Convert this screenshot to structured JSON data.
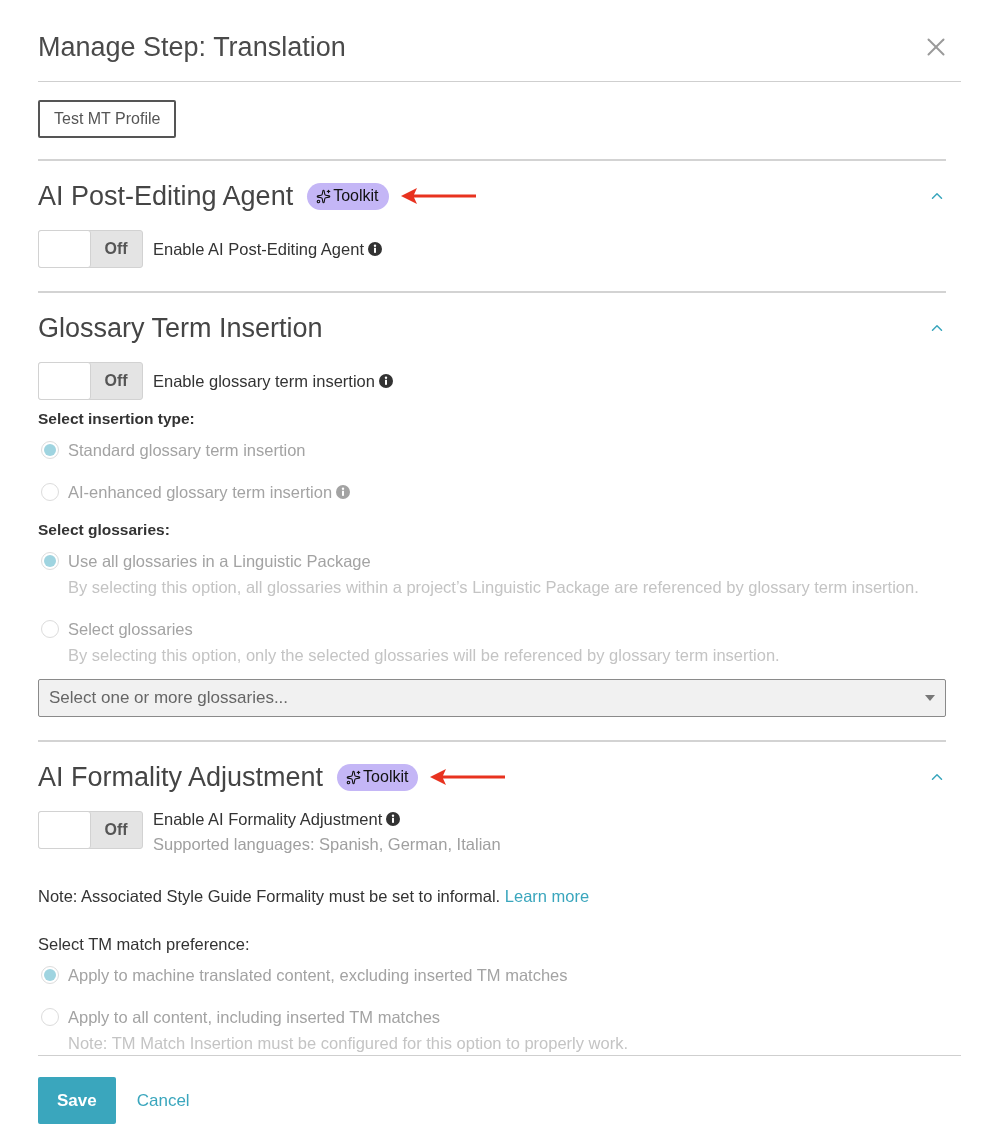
{
  "dialog": {
    "title": "Manage Step: Translation",
    "test_button": "Test MT Profile"
  },
  "sections": [
    {
      "title": "AI Post-Editing Agent",
      "badge": "Toolkit",
      "annotation_arrow": true,
      "expanded": true,
      "toggle": {
        "on": false,
        "state_label": "Off",
        "label": "Enable AI Post-Editing Agent",
        "info": true
      }
    },
    {
      "title": "Glossary Term Insertion",
      "expanded": true,
      "toggle": {
        "on": false,
        "state_label": "Off",
        "label": "Enable glossary term insertion",
        "info": true
      },
      "blocks": [
        {
          "kind": "heading",
          "text": "Select insertion type:",
          "bold": true
        },
        {
          "kind": "radio",
          "label": "Standard glossary term insertion",
          "selected": true,
          "disabled": true
        },
        {
          "kind": "radio",
          "label": "AI-enhanced glossary term insertion",
          "selected": false,
          "disabled": true,
          "info": true
        },
        {
          "kind": "heading",
          "text": "Select glossaries:",
          "bold": true
        },
        {
          "kind": "radio",
          "label": "Use all glossaries in a Linguistic Package",
          "description": "By selecting this option, all glossaries within a project’s Linguistic Package are referenced by glossary term insertion.",
          "selected": true,
          "disabled": true
        },
        {
          "kind": "radio",
          "label": "Select glossaries",
          "description": "By selecting this option, only the selected glossaries will be referenced by glossary term insertion.",
          "selected": false,
          "disabled": true
        },
        {
          "kind": "select",
          "placeholder": "Select one or more glossaries..."
        }
      ]
    },
    {
      "title": "AI Formality Adjustment",
      "badge": "Toolkit",
      "annotation_arrow": true,
      "expanded": true,
      "toggle": {
        "on": false,
        "state_label": "Off",
        "label": "Enable AI Formality Adjustment",
        "info": true,
        "sublabel": "Supported languages: Spanish, German, Italian"
      },
      "blocks": [
        {
          "kind": "note",
          "text": "Note: Associated Style Guide Formality must be set to informal.",
          "link": "Learn more"
        },
        {
          "kind": "heading",
          "text": "Select TM match preference:",
          "bold": false
        },
        {
          "kind": "radio",
          "label": "Apply to machine translated content, excluding inserted TM matches",
          "selected": true,
          "disabled": true
        },
        {
          "kind": "radio",
          "label": "Apply to all content, including inserted TM matches",
          "description": "Note: TM Match Insertion must be configured for this option to properly work.",
          "selected": false,
          "disabled": true
        }
      ]
    }
  ],
  "footer": {
    "buttons": [
      {
        "label": "Save",
        "kind": "primary"
      },
      {
        "label": "Cancel",
        "kind": "link"
      }
    ]
  }
}
